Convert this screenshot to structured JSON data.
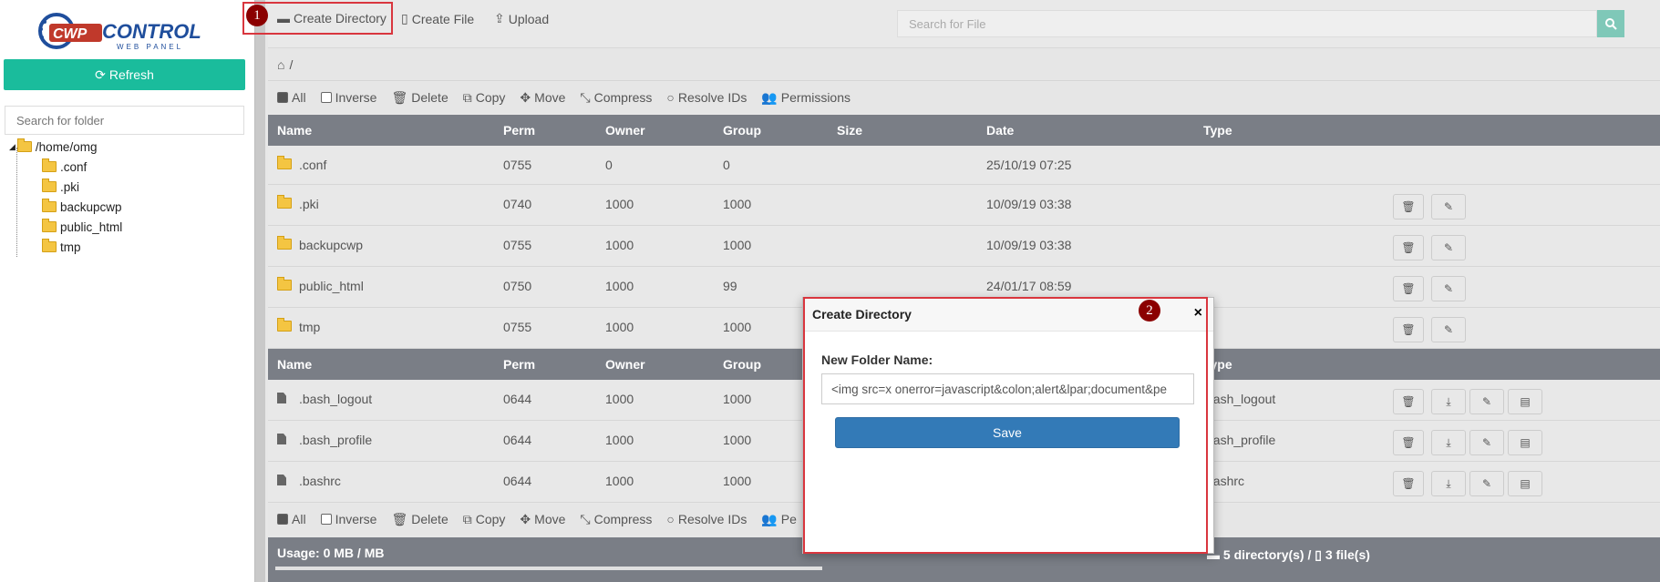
{
  "sidebar": {
    "logo_text": "CWPCONTROL",
    "logo_sub": "WEB PANEL",
    "refresh_label": "Refresh",
    "folder_search_placeholder": "Search for folder",
    "tree": {
      "root": "/home/omg",
      "children": [
        ".conf",
        ".pki",
        "backupcwp",
        "public_html",
        "tmp"
      ]
    }
  },
  "toolbar": {
    "create_directory": "Create Directory",
    "create_file": "Create File",
    "upload": "Upload",
    "search_placeholder": "Search for File"
  },
  "breadcrumb": {
    "path": "/"
  },
  "actions": {
    "all": "All",
    "inverse": "Inverse",
    "delete": "Delete",
    "copy": "Copy",
    "move": "Move",
    "compress": "Compress",
    "resolve_ids": "Resolve IDs",
    "permissions": "Permissions",
    "permissions_truncated": "Pe"
  },
  "columns": [
    "Name",
    "Perm",
    "Owner",
    "Group",
    "Size",
    "Date",
    "Type"
  ],
  "directories": [
    {
      "name": ".conf",
      "perm": "0755",
      "owner": "0",
      "group": "0",
      "date": "25/10/19 07:25"
    },
    {
      "name": ".pki",
      "perm": "0740",
      "owner": "1000",
      "group": "1000",
      "date": "10/09/19 03:38"
    },
    {
      "name": "backupcwp",
      "perm": "0755",
      "owner": "1000",
      "group": "1000",
      "date": "10/09/19 03:38"
    },
    {
      "name": "public_html",
      "perm": "0750",
      "owner": "1000",
      "group": "99",
      "date": "24/01/17 08:59"
    },
    {
      "name": "tmp",
      "perm": "0755",
      "owner": "1000",
      "group": "1000",
      "date": ""
    }
  ],
  "files": [
    {
      "name": ".bash_logout",
      "perm": "0644",
      "owner": "1000",
      "group": "1000",
      "type": "bash_logout"
    },
    {
      "name": ".bash_profile",
      "perm": "0644",
      "owner": "1000",
      "group": "1000",
      "type": "bash_profile"
    },
    {
      "name": ".bashrc",
      "perm": "0644",
      "owner": "1000",
      "group": "1000",
      "type": "bashrc"
    }
  ],
  "footer": {
    "usage": "Usage: 0 MB / MB",
    "summary": "5 directory(s) /",
    "summary_files": "3 file(s)"
  },
  "markers": {
    "one": "1",
    "two": "2"
  },
  "modal": {
    "title": "Create Directory",
    "close": "×",
    "label": "New Folder Name:",
    "input_value": "<img src=x onerror=javascript&colon;alert&lpar;document&pe",
    "save_label": "Save"
  },
  "colors": {
    "accent": "#1abc9c",
    "header": "#7a7e86",
    "primary": "#337ab7",
    "marker": "#8b0000",
    "highlight": "#d9363e"
  }
}
